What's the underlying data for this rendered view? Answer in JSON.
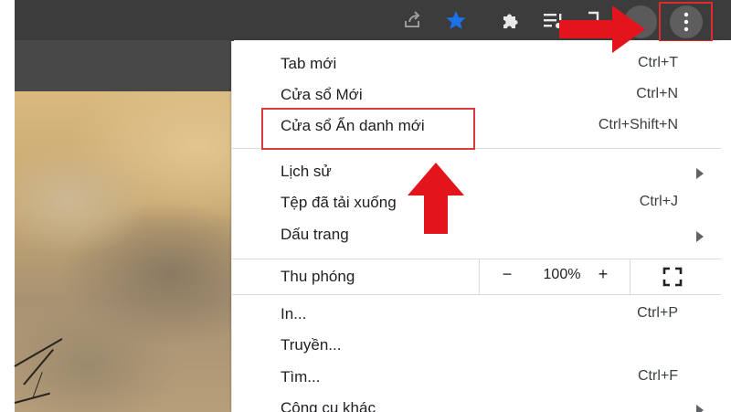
{
  "toolbar": {
    "icons": [
      "share-icon",
      "star-icon",
      "puzzle-icon",
      "media-control-icon",
      "side-panel-icon",
      "more-vert-icon"
    ],
    "bookmark_star_color": "#1a73e8",
    "menu_button_highlight_color": "#e02b2b"
  },
  "menu": {
    "items": [
      {
        "label": "Tab mới",
        "shortcut": "Ctrl+T"
      },
      {
        "label": "Cửa sổ Mới",
        "shortcut": "Ctrl+N"
      },
      {
        "label": "Cửa sổ Ẩn danh mới",
        "shortcut": "Ctrl+Shift+N"
      },
      {
        "label": "Lịch sử",
        "shortcut": ""
      },
      {
        "label": "Tệp đã tải xuống",
        "shortcut": "Ctrl+J"
      },
      {
        "label": "Dấu trang",
        "shortcut": ""
      },
      {
        "label": "In...",
        "shortcut": "Ctrl+P"
      },
      {
        "label": "Truyền...",
        "shortcut": ""
      },
      {
        "label": "Tìm...",
        "shortcut": "Ctrl+F"
      },
      {
        "label": "Công cụ khác",
        "shortcut": ""
      }
    ],
    "zoom": {
      "label": "Thu phóng",
      "minus": "−",
      "value": "100%",
      "plus": "+"
    }
  },
  "annotations": {
    "highlight_color": "#d93b3b",
    "arrow_color": "#e3141b"
  }
}
